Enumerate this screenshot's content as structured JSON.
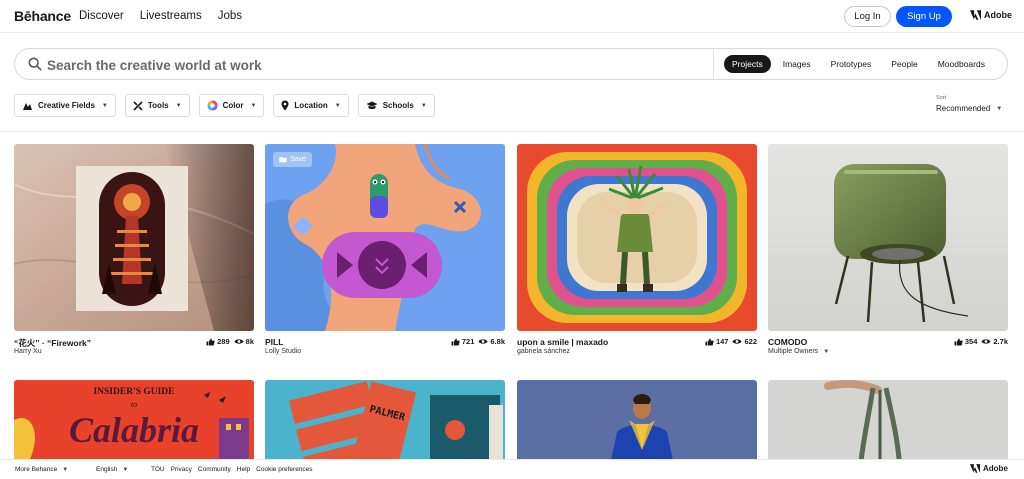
{
  "nav": {
    "logo": "Bēhance",
    "links": [
      "Discover",
      "Livestreams",
      "Jobs"
    ],
    "login": "Log In",
    "signup": "Sign Up",
    "adobe": "Adobe"
  },
  "search": {
    "placeholder": "Search the creative world at work",
    "tabs": [
      "Projects",
      "Images",
      "Prototypes",
      "People",
      "Moodboards"
    ],
    "active_tab": "Projects"
  },
  "filters": {
    "items": [
      "Creative Fields",
      "Tools",
      "Color",
      "Location",
      "Schools"
    ]
  },
  "sort": {
    "label": "Sort",
    "value": "Recommended"
  },
  "projects": [
    {
      "title": "“花火” · “Firework”",
      "owner": "Harry Xu",
      "likes": "289",
      "views": "8k"
    },
    {
      "title": "PILL",
      "owner": "Lolly Studio",
      "likes": "721",
      "views": "6.8k",
      "save": "Save"
    },
    {
      "title": "upon a smile | maxado",
      "owner": "gabriela sánchez",
      "likes": "147",
      "views": "622"
    },
    {
      "title": "COMODO",
      "owner": "Multiple Owners",
      "likes": "354",
      "views": "2.7k"
    }
  ],
  "row2": {
    "calabria_top": "INSIDER'S GUIDE",
    "calabria_to": "to",
    "calabria_word": "Calabria",
    "palmer": "PALMER"
  },
  "footer": {
    "more": "More Behance",
    "language": "English",
    "links": [
      "TOU",
      "Privacy",
      "Community",
      "Help",
      "Cookie preferences"
    ],
    "adobe": "Adobe"
  },
  "colors": {
    "brand_blue": "#0057ff",
    "active_tab_bg": "#191919"
  }
}
